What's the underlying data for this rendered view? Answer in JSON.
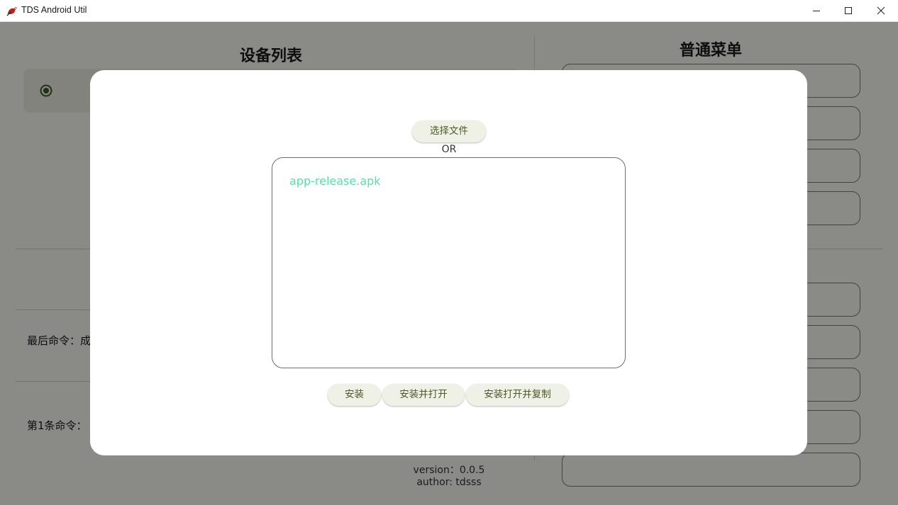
{
  "window": {
    "title": "TDS Android Util",
    "icon": "tds-app-icon",
    "controls": [
      "minimize-icon",
      "maximize-icon",
      "close-icon"
    ]
  },
  "device_panel": {
    "title": "设备列表",
    "radio_selected": true
  },
  "menu_panel": {
    "title": "普通菜单"
  },
  "commands": {
    "last_label": "最后命令：成",
    "first_label": "第1条命令："
  },
  "footer": {
    "version": "version：0.0.5",
    "author": "author: tdsss"
  },
  "dialog": {
    "choose_file_label": "选择文件",
    "or_text": "OR",
    "selected_file": "app-release.apk",
    "buttons": {
      "install": "安装",
      "install_open": "安装并打开",
      "install_open_copy": "安装打开并复制"
    }
  },
  "colors": {
    "overlay": "#737373",
    "dialog_bg": "#ffffff",
    "file_name": "#58e0a8",
    "button_bg": "#f0f1e6",
    "button_text": "#4a5a2a",
    "radio": "#3d5a2a"
  }
}
